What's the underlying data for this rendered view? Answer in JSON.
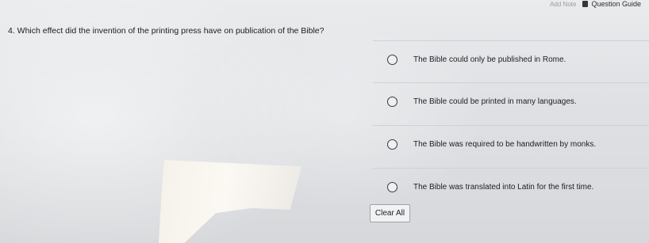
{
  "header": {
    "faint_label": "Add Note",
    "guide_label": "Question Guide"
  },
  "question": {
    "text": "4. Which effect did the invention of the printing press have on publication of the Bible?"
  },
  "options": [
    {
      "label": "The Bible could only be published in Rome.",
      "selected": false
    },
    {
      "label": "The Bible could be printed in many languages.",
      "selected": false
    },
    {
      "label": "The Bible was required to be handwritten by monks.",
      "selected": false
    },
    {
      "label": "The Bible was translated into Latin for the first time.",
      "selected": false
    }
  ],
  "actions": {
    "clear_label": "Clear All"
  }
}
